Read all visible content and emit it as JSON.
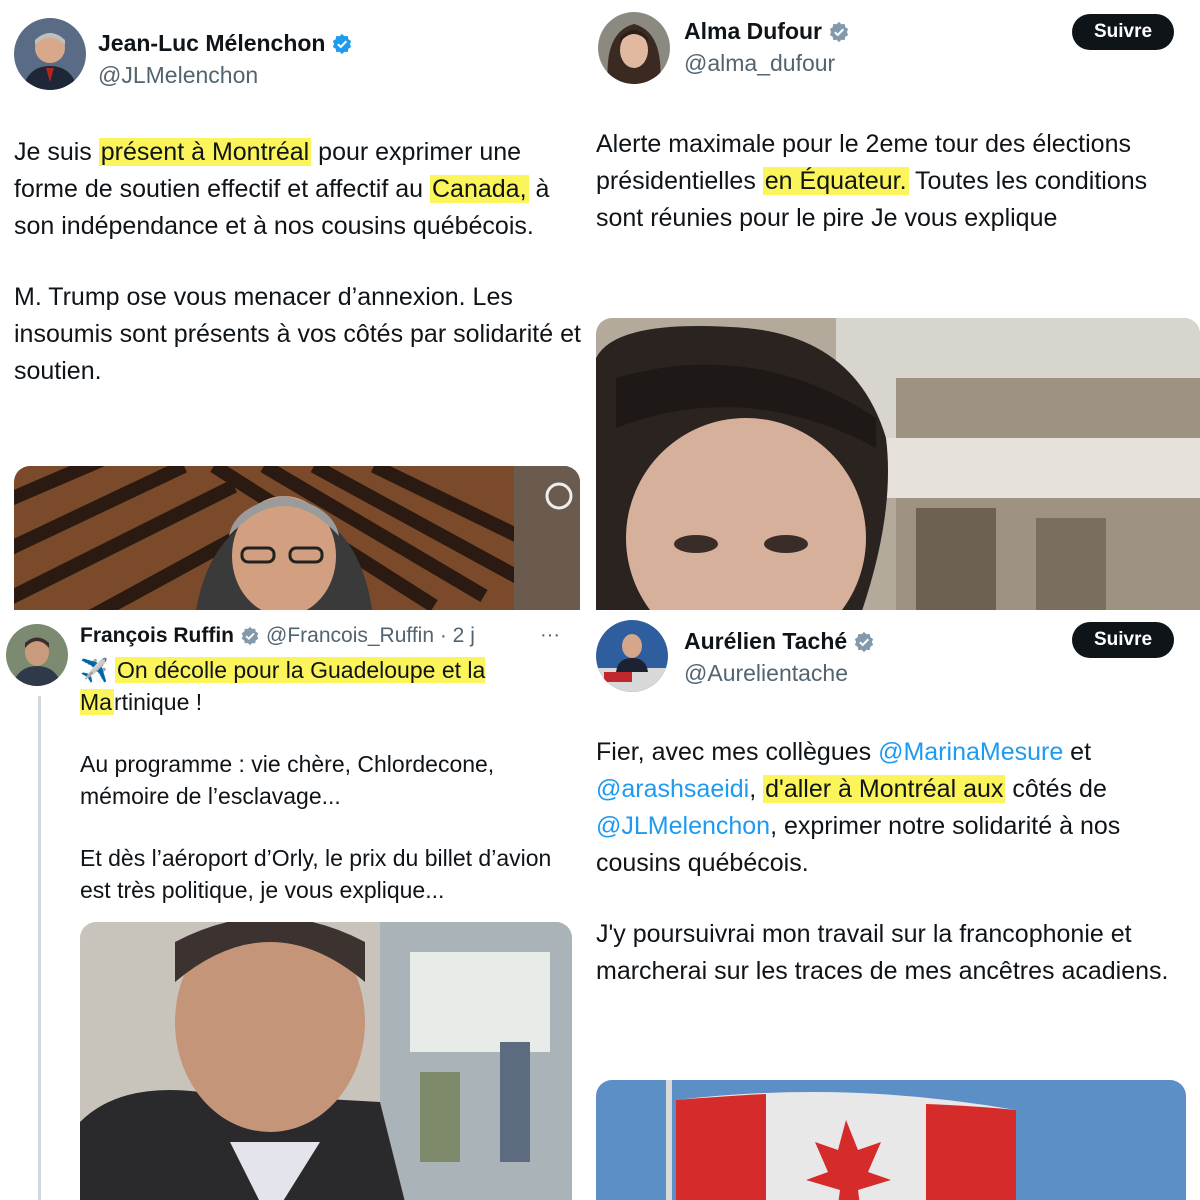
{
  "tweets": [
    {
      "author_name": "Jean-Luc Mélenchon",
      "handle": "@JLMelenchon",
      "text_part1": "Je suis ",
      "text_hl1": "présent à Montréal",
      "text_part2": " pour exprimer une forme de soutien effectif et affectif au ",
      "text_hl2": "Canada,",
      "text_part3": " à son indépendance et à nos cousins québécois.",
      "paragraph2": "M. Trump ose vous menacer d’annexion. Les insoumis sont présents à vos côtés par solidarité et soutien.",
      "media_desc": "studio-portrait"
    },
    {
      "author_name": "Alma Dufour",
      "handle": "@alma_dufour",
      "follow_label": "Suivre",
      "text_part1": "Alerte maximale pour le 2eme tour des élections présidentielles ",
      "text_hl1": "en Équateur.",
      "text_part2": " Toutes les conditions sont réunies pour le pire Je vous explique"
    },
    {
      "author_name": "François Ruffin",
      "handle": "@Francois_Ruffin · 2 j",
      "more_label": "···",
      "plane_icon": "✈️",
      "text_hl1": "On décolle pour la Guadeloupe et la Ma",
      "text_part1": "rtinique !",
      "paragraph2": "Au programme : vie chère, Chlordecone, mémoire de l’esclavage...",
      "paragraph3": "Et dès l’aéroport d’Orly, le prix du billet d’avion est très politique, je vous explique..."
    },
    {
      "author_name": "Aurélien Taché",
      "handle": "@Aurelientache",
      "follow_label": "Suivre",
      "text_part1": "Fier, avec mes collègues ",
      "mention1": "@MarinaMesure",
      "text_part2": " et ",
      "mention2": "@arashsaeidi",
      "text_part3": ", ",
      "text_hl1": "d'aller à Montréal aux",
      "text_part4": " côtés de ",
      "mention3": "@JLMelenchon",
      "text_part5": ", exprimer notre solidarité à nos cousins québécois.",
      "paragraph2": "J'y poursuivrai mon travail sur la francophonie et marcherai sur les traces de mes ancêtres acadiens."
    }
  ],
  "colors": {
    "highlight": "#fbf45a",
    "mention": "#1d9bf0",
    "verified": "#829aab",
    "text": "#0f1419",
    "handle": "#536471"
  }
}
